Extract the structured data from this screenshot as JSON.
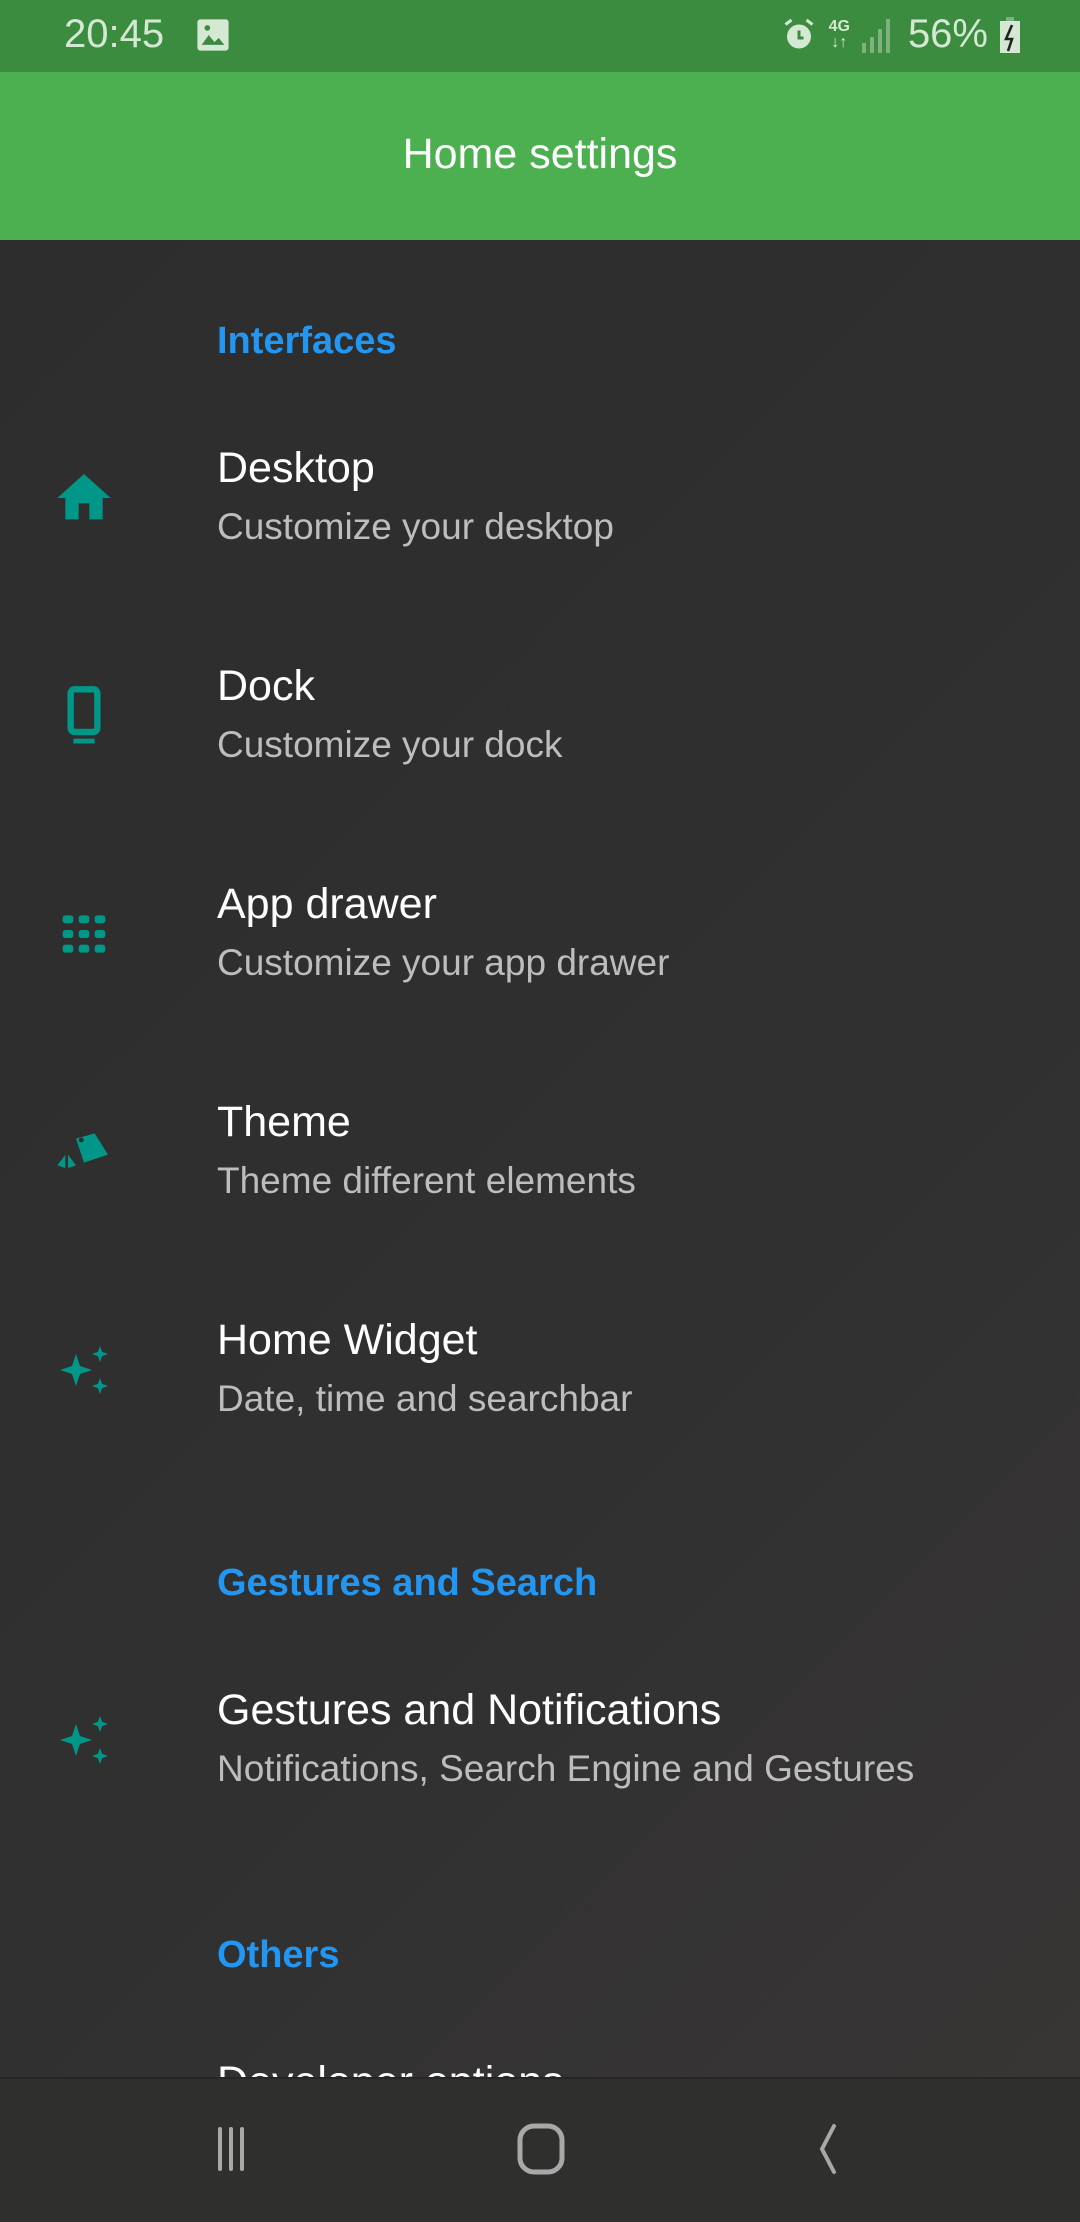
{
  "status_bar": {
    "time": "20:45",
    "battery": "56%",
    "network": "4G",
    "icons": [
      "image-icon",
      "alarm-icon",
      "data-4g-icon",
      "signal-icon",
      "battery-charging-icon"
    ]
  },
  "app_bar": {
    "title": "Home settings"
  },
  "colors": {
    "accent": "#2196f3",
    "icon": "#009688",
    "app_bar": "#4caf50",
    "status_bar": "#3c8c40"
  },
  "sections": [
    {
      "header": "Interfaces",
      "items": [
        {
          "title": "Desktop",
          "subtitle": "Customize your desktop",
          "icon": "home-icon"
        },
        {
          "title": "Dock",
          "subtitle": "Customize your dock",
          "icon": "dock-icon"
        },
        {
          "title": "App drawer",
          "subtitle": "Customize your app drawer",
          "icon": "app-grid-icon"
        },
        {
          "title": "Theme",
          "subtitle": "Theme different elements",
          "icon": "theme-swatch-icon"
        },
        {
          "title": "Home Widget",
          "subtitle": "Date, time and searchbar",
          "icon": "sparkle-icon"
        }
      ]
    },
    {
      "header": "Gestures and Search",
      "items": [
        {
          "title": "Gestures and Notifications",
          "subtitle": "Notifications, Search Engine and Gestures",
          "icon": "sparkle-icon"
        }
      ]
    },
    {
      "header": "Others",
      "items": [
        {
          "title": "Developer options"
        }
      ]
    }
  ],
  "nav_bar": {
    "buttons": [
      "recents",
      "home",
      "back"
    ]
  }
}
